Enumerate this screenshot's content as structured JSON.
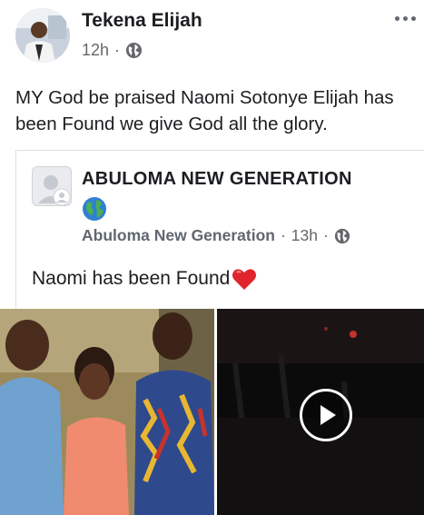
{
  "post": {
    "author": "Tekena Elijah",
    "time": "12h",
    "separator": "·",
    "audience_icon": "globe-icon",
    "text": "MY God be praised Naomi Sotonye Elijah has been Found we give God all the glory."
  },
  "shared_post": {
    "page_name": "ABULOMA NEW GENERATION",
    "page_emoji": "globe-emoji",
    "subtitle": "Abuloma New Generation",
    "time": "13h",
    "separator": "·",
    "audience_icon": "globe-icon",
    "text": "Naomi has been Found",
    "text_emoji": "red-heart-emoji"
  },
  "media": {
    "items": [
      {
        "type": "photo",
        "description_icon": "group-photo"
      },
      {
        "type": "video",
        "control_icon": "play-icon"
      }
    ]
  },
  "colors": {
    "primary_text": "#1c1e21",
    "secondary_text": "#65676b",
    "border": "#dadde1",
    "background": "#ffffff"
  }
}
